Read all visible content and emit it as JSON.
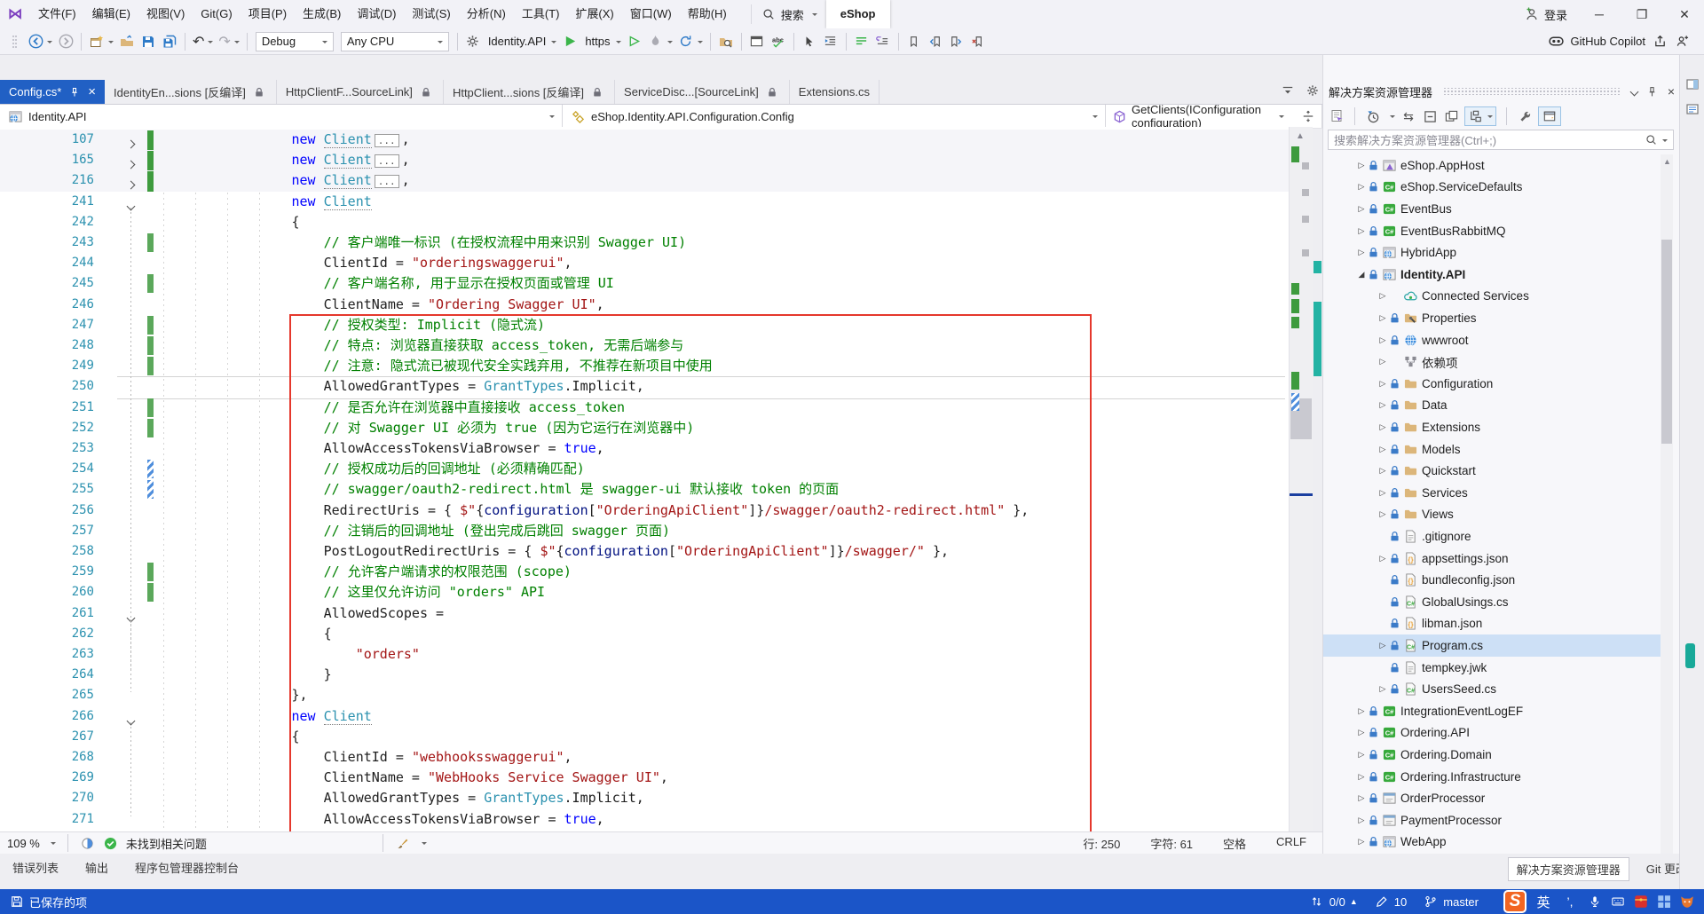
{
  "colors": {
    "accent": "#2160C4",
    "statusbar": "#1B55C8",
    "annotation_red": "#E5382C",
    "keyword": "#0000FF",
    "type": "#2B91AF",
    "string": "#A31515",
    "comment": "#008000"
  },
  "title_bar": {
    "menus": [
      "文件(F)",
      "编辑(E)",
      "视图(V)",
      "Git(G)",
      "项目(P)",
      "生成(B)",
      "调试(D)",
      "测试(S)",
      "分析(N)",
      "工具(T)",
      "扩展(X)",
      "窗口(W)",
      "帮助(H)"
    ],
    "search_label": "搜索",
    "solution_badge": "eShop",
    "sign_in": "登录",
    "window_buttons": [
      "─",
      "❐",
      "✕"
    ]
  },
  "toolbar": {
    "debug_config": "Debug",
    "platform": "Any CPU",
    "startup_project": "Identity.API",
    "run_profile": "https",
    "copilot_label": "GitHub Copilot"
  },
  "tabs": [
    {
      "label": "Config.cs*",
      "active": true,
      "pin": true,
      "close": true
    },
    {
      "label": "IdentityEn...sions [反编译]",
      "lock": true
    },
    {
      "label": "HttpClientF...SourceLink]",
      "lock": true
    },
    {
      "label": "HttpClient...sions [反编译]",
      "lock": true
    },
    {
      "label": "ServiceDisc...[SourceLink]",
      "lock": true
    },
    {
      "label": "Extensions.cs"
    }
  ],
  "breadcrumb": {
    "project": "Identity.API",
    "type": "eShop.Identity.API.Configuration.Config",
    "member": "GetClients(IConfiguration configuration)"
  },
  "editor": {
    "lines": [
      {
        "n": 107,
        "f": "c",
        "b": "G",
        "ind": 16,
        "dim": true,
        "box": true,
        "segs": [
          [
            "k",
            "new"
          ],
          [
            "p",
            " "
          ],
          [
            "tu",
            "Client"
          ]
        ]
      },
      {
        "n": 165,
        "f": "c",
        "b": "G",
        "ind": 16,
        "dim": true,
        "box": true,
        "segs": [
          [
            "k",
            "new"
          ],
          [
            "p",
            " "
          ],
          [
            "tu",
            "Client"
          ]
        ]
      },
      {
        "n": 216,
        "f": "c",
        "b": "G",
        "ind": 16,
        "dim": true,
        "box": true,
        "segs": [
          [
            "k",
            "new"
          ],
          [
            "p",
            " "
          ],
          [
            "tu",
            "Client"
          ]
        ]
      },
      {
        "n": 241,
        "f": "e",
        "ind": 16,
        "segs": [
          [
            "k",
            "new"
          ],
          [
            "p",
            " "
          ],
          [
            "tu",
            "Client"
          ]
        ]
      },
      {
        "n": 242,
        "ind": 16,
        "segs": [
          [
            "p",
            "{"
          ]
        ]
      },
      {
        "n": 243,
        "b": "g",
        "ind": 20,
        "segs": [
          [
            "c",
            "// 客户端唯一标识 (在授权流程中用来识别 Swagger UI)"
          ]
        ]
      },
      {
        "n": 244,
        "ind": 20,
        "segs": [
          [
            "p",
            "ClientId = "
          ],
          [
            "s",
            "\"orderingswaggerui\""
          ],
          [
            "p",
            ","
          ]
        ]
      },
      {
        "n": 245,
        "b": "g",
        "ind": 20,
        "segs": [
          [
            "c",
            "// 客户端名称, 用于显示在授权页面或管理 UI"
          ]
        ]
      },
      {
        "n": 246,
        "ind": 20,
        "segs": [
          [
            "p",
            "ClientName = "
          ],
          [
            "s",
            "\"Ordering Swagger UI\""
          ],
          [
            "p",
            ","
          ]
        ]
      },
      {
        "n": 247,
        "b": "g",
        "ind": 20,
        "segs": [
          [
            "c",
            "// 授权类型: Implicit (隐式流)"
          ]
        ]
      },
      {
        "n": 248,
        "b": "g",
        "ind": 20,
        "segs": [
          [
            "c",
            "// 特点: 浏览器直接获取 access_token, 无需后端参与"
          ]
        ]
      },
      {
        "n": 249,
        "b": "g",
        "ind": 20,
        "segs": [
          [
            "c",
            "// 注意: 隐式流已被现代安全实践弃用, 不推荐在新项目中使用"
          ]
        ]
      },
      {
        "n": 250,
        "cur": true,
        "ind": 20,
        "segs": [
          [
            "p",
            "AllowedGrantTypes = "
          ],
          [
            "t",
            "GrantTypes"
          ],
          [
            "p",
            ".Implicit,"
          ]
        ]
      },
      {
        "n": 251,
        "b": "g",
        "ind": 20,
        "segs": [
          [
            "c",
            "// 是否允许在浏览器中直接接收 access_token"
          ]
        ]
      },
      {
        "n": 252,
        "b": "g",
        "ind": 20,
        "segs": [
          [
            "c",
            "// 对 Swagger UI 必须为 true (因为它运行在浏览器中)"
          ]
        ]
      },
      {
        "n": 253,
        "ind": 20,
        "segs": [
          [
            "p",
            "AllowAccessTokensViaBrowser = "
          ],
          [
            "k",
            "true"
          ],
          [
            "p",
            ","
          ]
        ]
      },
      {
        "n": 254,
        "b": "h",
        "ind": 20,
        "segs": [
          [
            "c",
            "// 授权成功后的回调地址 (必须精确匹配)"
          ]
        ]
      },
      {
        "n": 255,
        "b": "h",
        "ind": 20,
        "segs": [
          [
            "c",
            "// swagger/oauth2-redirect.html 是 swagger-ui 默认接收 token 的页面"
          ]
        ]
      },
      {
        "n": 256,
        "ind": 20,
        "segs": [
          [
            "p",
            "RedirectUris = { "
          ],
          [
            "s",
            "$\""
          ],
          [
            "p",
            "{"
          ],
          [
            "i",
            "configuration"
          ],
          [
            "p",
            "["
          ],
          [
            "s",
            "\"OrderingApiClient\""
          ],
          [
            "p",
            "]}"
          ],
          [
            "s",
            "/swagger/oauth2-redirect.html\""
          ],
          [
            "p",
            " },"
          ]
        ]
      },
      {
        "n": 257,
        "ind": 20,
        "segs": [
          [
            "c",
            "// 注销后的回调地址 (登出完成后跳回 swagger 页面)"
          ]
        ]
      },
      {
        "n": 258,
        "ind": 20,
        "segs": [
          [
            "p",
            "PostLogoutRedirectUris = { "
          ],
          [
            "s",
            "$\""
          ],
          [
            "p",
            "{"
          ],
          [
            "i",
            "configuration"
          ],
          [
            "p",
            "["
          ],
          [
            "s",
            "\"OrderingApiClient\""
          ],
          [
            "p",
            "]}"
          ],
          [
            "s",
            "/swagger/\""
          ],
          [
            "p",
            " },"
          ]
        ]
      },
      {
        "n": 259,
        "b": "g",
        "ind": 20,
        "segs": [
          [
            "c",
            "// 允许客户端请求的权限范围 (scope)"
          ]
        ]
      },
      {
        "n": 260,
        "b": "g",
        "ind": 20,
        "segs": [
          [
            "c",
            "// 这里仅允许访问 \"orders\" API"
          ]
        ]
      },
      {
        "n": 261,
        "f": "e",
        "ind": 20,
        "segs": [
          [
            "p",
            "AllowedScopes ="
          ]
        ]
      },
      {
        "n": 262,
        "ind": 20,
        "segs": [
          [
            "p",
            "{"
          ]
        ]
      },
      {
        "n": 263,
        "ind": 24,
        "segs": [
          [
            "s",
            "\"orders\""
          ]
        ]
      },
      {
        "n": 264,
        "ind": 20,
        "segs": [
          [
            "p",
            "}"
          ]
        ]
      },
      {
        "n": 265,
        "ind": 16,
        "segs": [
          [
            "p",
            "},"
          ]
        ]
      },
      {
        "n": 266,
        "f": "e",
        "ind": 16,
        "segs": [
          [
            "k",
            "new"
          ],
          [
            "p",
            " "
          ],
          [
            "tu",
            "Client"
          ]
        ]
      },
      {
        "n": 267,
        "ind": 16,
        "segs": [
          [
            "p",
            "{"
          ]
        ]
      },
      {
        "n": 268,
        "ind": 20,
        "segs": [
          [
            "p",
            "ClientId = "
          ],
          [
            "s",
            "\"webhooksswaggerui\""
          ],
          [
            "p",
            ","
          ]
        ]
      },
      {
        "n": 269,
        "ind": 20,
        "segs": [
          [
            "p",
            "ClientName = "
          ],
          [
            "s",
            "\"WebHooks Service Swagger UI\""
          ],
          [
            "p",
            ","
          ]
        ]
      },
      {
        "n": 270,
        "ind": 20,
        "segs": [
          [
            "p",
            "AllowedGrantTypes = "
          ],
          [
            "t",
            "GrantTypes"
          ],
          [
            "p",
            ".Implicit,"
          ]
        ]
      },
      {
        "n": 271,
        "ind": 20,
        "segs": [
          [
            "p",
            "AllowAccessTokensViaBrowser = "
          ],
          [
            "k",
            "true"
          ],
          [
            "p",
            ","
          ]
        ]
      }
    ]
  },
  "editor_status": {
    "zoom": "109 %",
    "problems": "未找到相关问题",
    "line": "行: 250",
    "column": "字符: 61",
    "spaces": "空格",
    "eol": "CRLF"
  },
  "panel_tabs": [
    "错误列表",
    "输出",
    "程序包管理器控制台"
  ],
  "explorer": {
    "title": "解决方案资源管理器",
    "search_placeholder": "搜索解决方案资源管理器(Ctrl+;)",
    "items": [
      {
        "label": "eShop.AppHost",
        "level": 0,
        "arrow": "c",
        "lock": true,
        "icon": "apphost"
      },
      {
        "label": "eShop.ServiceDefaults",
        "level": 0,
        "arrow": "c",
        "lock": true,
        "icon": "cs"
      },
      {
        "label": "EventBus",
        "level": 0,
        "arrow": "c",
        "lock": true,
        "icon": "cs"
      },
      {
        "label": "EventBusRabbitMQ",
        "level": 0,
        "arrow": "c",
        "lock": true,
        "icon": "cs"
      },
      {
        "label": "HybridApp",
        "level": 0,
        "arrow": "c",
        "lock": true,
        "icon": "web"
      },
      {
        "label": "Identity.API",
        "level": 0,
        "arrow": "e",
        "lock": true,
        "icon": "web",
        "bold": true
      },
      {
        "label": "Connected Services",
        "level": 1,
        "arrow": "c",
        "icon": "cloud"
      },
      {
        "label": "Properties",
        "level": 1,
        "arrow": "c",
        "lock": true,
        "icon": "props"
      },
      {
        "label": "wwwroot",
        "level": 1,
        "arrow": "c",
        "lock": true,
        "icon": "globe"
      },
      {
        "label": "依赖项",
        "level": 1,
        "arrow": "c",
        "icon": "deps"
      },
      {
        "label": "Configuration",
        "level": 1,
        "arrow": "c",
        "lock": true,
        "icon": "folder"
      },
      {
        "label": "Data",
        "level": 1,
        "arrow": "c",
        "lock": true,
        "icon": "folder"
      },
      {
        "label": "Extensions",
        "level": 1,
        "arrow": "c",
        "lock": true,
        "icon": "folder"
      },
      {
        "label": "Models",
        "level": 1,
        "arrow": "c",
        "lock": true,
        "icon": "folder"
      },
      {
        "label": "Quickstart",
        "level": 1,
        "arrow": "c",
        "lock": true,
        "icon": "folder"
      },
      {
        "label": "Services",
        "level": 1,
        "arrow": "c",
        "lock": true,
        "icon": "folder"
      },
      {
        "label": "Views",
        "level": 1,
        "arrow": "c",
        "lock": true,
        "icon": "folder"
      },
      {
        "label": ".gitignore",
        "level": 1,
        "lock": true,
        "icon": "file"
      },
      {
        "label": "appsettings.json",
        "level": 1,
        "arrow": "c",
        "lock": true,
        "icon": "json"
      },
      {
        "label": "bundleconfig.json",
        "level": 1,
        "lock": true,
        "icon": "json"
      },
      {
        "label": "GlobalUsings.cs",
        "level": 1,
        "lock": true,
        "icon": "csfile"
      },
      {
        "label": "libman.json",
        "level": 1,
        "lock": true,
        "icon": "json"
      },
      {
        "label": "Program.cs",
        "level": 1,
        "arrow": "c",
        "lock": true,
        "icon": "csfile",
        "selected": true
      },
      {
        "label": "tempkey.jwk",
        "level": 1,
        "lock": true,
        "icon": "file"
      },
      {
        "label": "UsersSeed.cs",
        "level": 1,
        "arrow": "c",
        "lock": true,
        "icon": "csfile"
      },
      {
        "label": "IntegrationEventLogEF",
        "level": 0,
        "arrow": "c",
        "lock": true,
        "icon": "cs"
      },
      {
        "label": "Ordering.API",
        "level": 0,
        "arrow": "c",
        "lock": true,
        "icon": "cs"
      },
      {
        "label": "Ordering.Domain",
        "level": 0,
        "arrow": "c",
        "lock": true,
        "icon": "cs"
      },
      {
        "label": "Ordering.Infrastructure",
        "level": 0,
        "arrow": "c",
        "lock": true,
        "icon": "cs"
      },
      {
        "label": "OrderProcessor",
        "level": 0,
        "arrow": "c",
        "lock": true,
        "icon": "winapp"
      },
      {
        "label": "PaymentProcessor",
        "level": 0,
        "arrow": "c",
        "lock": true,
        "icon": "winapp"
      },
      {
        "label": "WebApp",
        "level": 0,
        "arrow": "c",
        "lock": true,
        "icon": "web"
      }
    ],
    "tabs": [
      {
        "label": "解决方案资源管理器",
        "active": true
      },
      {
        "label": "Git 更改"
      }
    ]
  },
  "status_bar": {
    "saved": "已保存的项",
    "items": [
      {
        "name": "errors-warnings",
        "icon": "updown",
        "label": "0/0",
        "caret": "▲"
      },
      {
        "name": "pending-edits",
        "icon": "pencil",
        "label": "10"
      },
      {
        "name": "git-branch",
        "icon": "branch",
        "label": "master"
      }
    ],
    "ime": {
      "s_logo": "S",
      "lang": "英",
      "punct": "’,"
    }
  }
}
